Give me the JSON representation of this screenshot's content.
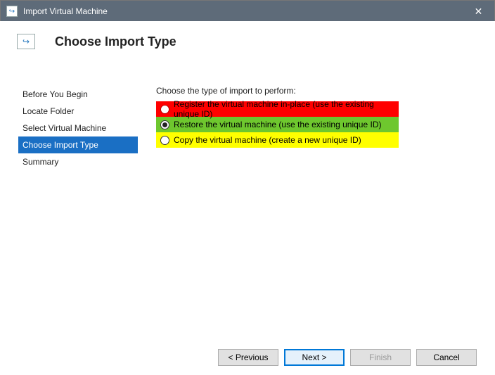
{
  "window": {
    "title": "Import Virtual Machine",
    "close_glyph": "✕"
  },
  "header": {
    "title": "Choose Import Type",
    "icon_glyph": "↪"
  },
  "nav": {
    "items": [
      {
        "label": "Before You Begin"
      },
      {
        "label": "Locate Folder"
      },
      {
        "label": "Select Virtual Machine"
      },
      {
        "label": "Choose Import Type"
      },
      {
        "label": "Summary"
      }
    ],
    "selected_index": 3
  },
  "content": {
    "prompt": "Choose the type of import to perform:",
    "options": [
      {
        "label": "Register the virtual machine in-place (use the existing unique ID)",
        "highlight": "red",
        "selected": false
      },
      {
        "label": "Restore the virtual machine (use the existing unique ID)",
        "highlight": "green",
        "selected": true
      },
      {
        "label": "Copy the virtual machine (create a new unique ID)",
        "highlight": "yellow",
        "selected": false
      }
    ]
  },
  "footer": {
    "previous": "< Previous",
    "next": "Next >",
    "finish": "Finish",
    "cancel": "Cancel",
    "finish_enabled": false
  }
}
